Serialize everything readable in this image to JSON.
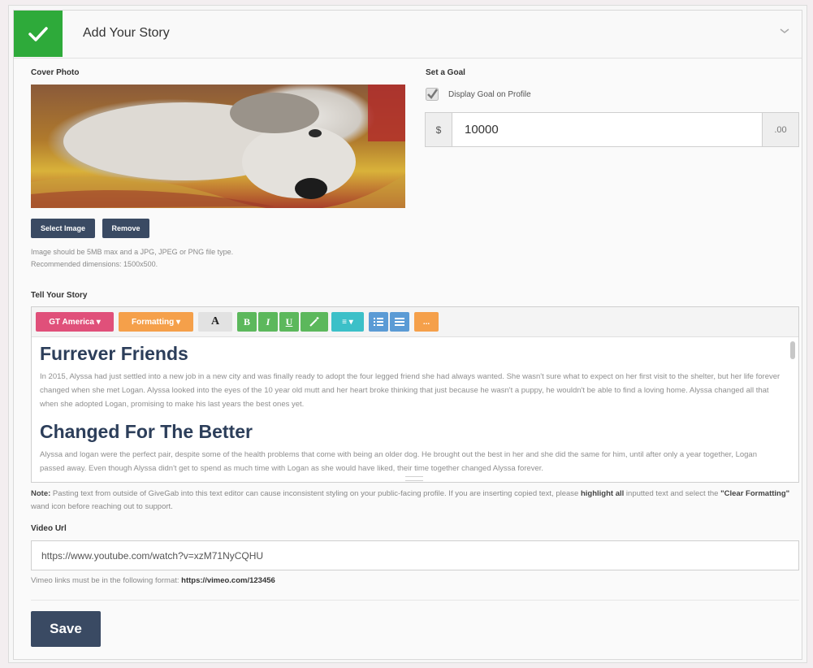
{
  "header": {
    "title": "Add Your Story"
  },
  "cover": {
    "label": "Cover Photo",
    "select_label": "Select Image",
    "remove_label": "Remove",
    "help_line1": "Image should be 5MB max and a JPG, JPEG or PNG file type.",
    "help_line2": "Recommended dimensions: 1500x500."
  },
  "goal": {
    "label": "Set a Goal",
    "checkbox_label": "Display Goal on Profile",
    "checked": true,
    "currency": "$",
    "value": "10000",
    "suffix": ".00"
  },
  "story": {
    "label": "Tell Your Story",
    "toolbar": {
      "font": "GT America ▾",
      "formatting": "Formatting ▾",
      "font_color": "A",
      "bold": "B",
      "italic": "I",
      "underline": "U",
      "align": "≡ ▾",
      "more": "..."
    },
    "heading1": "Furrever Friends",
    "para1": "In 2015, Alyssa had just settled into a new job in a new city and was finally ready to adopt the four legged friend she had always wanted. She wasn't sure what to expect on her first visit to the shelter, but her life forever changed when she met Logan. Alyssa looked into the eyes of the 10 year old mutt and her heart broke thinking that just because he wasn't a puppy, he wouldn't be able to find a loving home. Alyssa changed all that when she adopted Logan, promising to make his last years the best ones yet.",
    "heading2": "Changed For The Better",
    "para2": "Alyssa and logan were the perfect pair, despite some of the health problems that come with being an older dog. He brought out the best in her and she did the same for him, until after only a year together, Logan passed away. Even though Alyssa didn't get to spend as much time with Logan as she would have liked, their time together changed Alyssa forever."
  },
  "note": {
    "prefix": "Note:",
    "text1": " Pasting text from outside of GiveGab into this text editor can cause inconsistent styling on your public-facing profile. If you are inserting copied text, please ",
    "bold1": "highlight all",
    "text2": " inputted text and select the ",
    "bold2": "\"Clear Formatting\"",
    "text3": " wand icon before reaching out to support."
  },
  "video": {
    "label": "Video Url",
    "value": "https://www.youtube.com/watch?v=xzM71NyCQHU",
    "help_prefix": "Vimeo links must be in the following format: ",
    "help_example": "https://vimeo.com/123456"
  },
  "save_label": "Save",
  "colors": {
    "check_green": "#2eaa3a",
    "navy": "#3a4a63",
    "font_pink": "#e0507a",
    "format_orange": "#f5a04a",
    "style_green": "#5cb85c",
    "align_teal": "#3cc0c8",
    "list_blue": "#5b9bd5",
    "more_orange": "#f5a04a"
  }
}
